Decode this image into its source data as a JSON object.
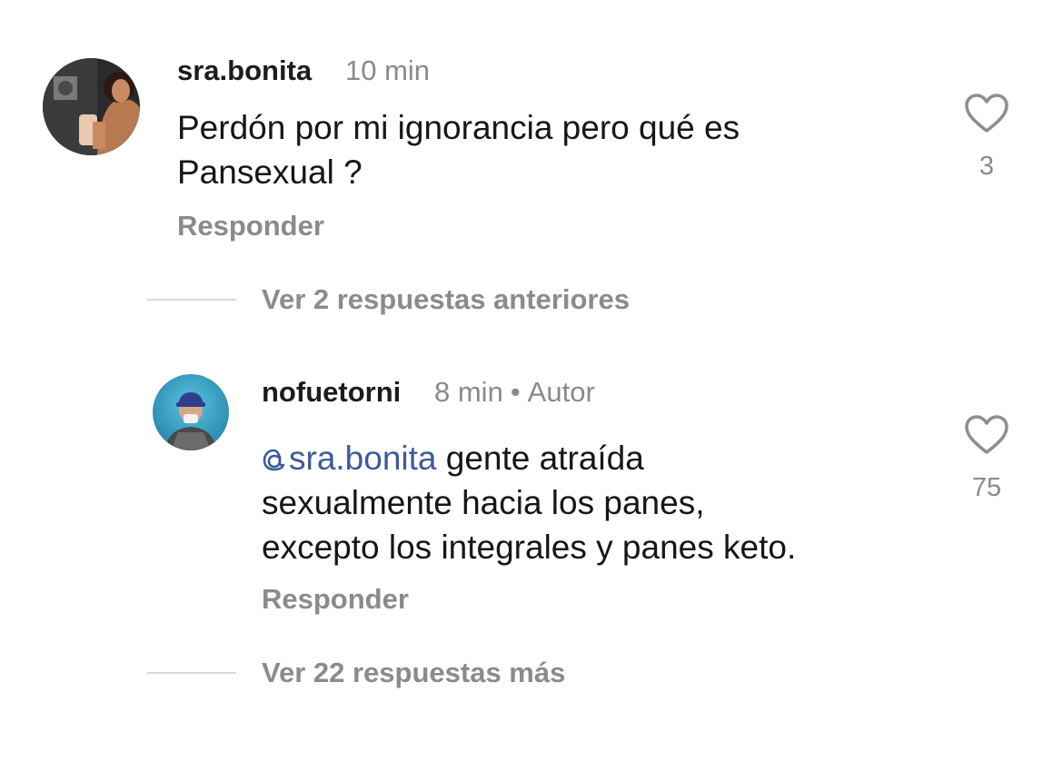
{
  "comments": [
    {
      "username": "sra.bonita",
      "time": "10 min",
      "text_line1": "Perdón por mi ignorancia pero qué es",
      "text_line2": "Pansexual ?",
      "likes": "3",
      "reply_label": "Responder"
    },
    {
      "username": "nofuetorni",
      "time": "8 min",
      "author_badge": "Autor",
      "mention": "sra.bonita",
      "text_line1_rest": " gente atraída",
      "text_line2": "sexualmente hacia los panes,",
      "text_line3": "excepto los integrales y panes keto.",
      "likes": "75",
      "reply_label": "Responder"
    }
  ],
  "view_previous_label": "Ver 2 respuestas anteriores",
  "view_more_label": "Ver 22 respuestas más",
  "icons": {
    "like": "heart-outline-icon",
    "mention": "threads-at-icon",
    "separator": "dot"
  },
  "colors": {
    "mention": "#3d5a99",
    "muted": "#8b8b8b",
    "text": "#161616"
  }
}
